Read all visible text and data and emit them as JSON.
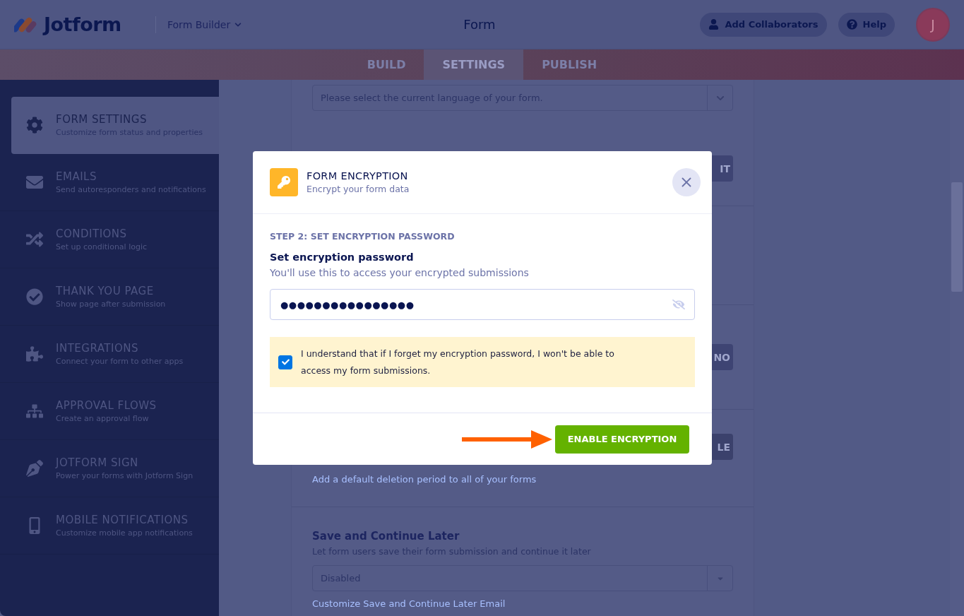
{
  "header": {
    "logo": "Jotform",
    "builder_menu": "Form Builder",
    "title": "Form",
    "buttons": [
      {
        "kind": "collaborators",
        "label": "Add Collaborators"
      },
      {
        "kind": "help",
        "label": "Help"
      }
    ],
    "avatar": "J"
  },
  "tabs": [
    {
      "label": "BUILD",
      "selected": false
    },
    {
      "label": "SETTINGS",
      "selected": true
    },
    {
      "label": "PUBLISH",
      "selected": false
    }
  ],
  "sidebar": {
    "items": [
      {
        "kind": "gear",
        "title": "FORM SETTINGS",
        "subtitle": "Customize form status and properties",
        "selected": true
      },
      {
        "kind": "mail",
        "title": "EMAILS",
        "subtitle": "Send autoresponders and notifications",
        "selected": false
      },
      {
        "kind": "shuffle",
        "title": "CONDITIONS",
        "subtitle": "Set up conditional logic",
        "selected": false
      },
      {
        "kind": "check",
        "title": "THANK YOU PAGE",
        "subtitle": "Show page after submission",
        "selected": false
      },
      {
        "kind": "puzzle",
        "title": "INTEGRATIONS",
        "subtitle": "Connect your form to other apps",
        "selected": false
      },
      {
        "kind": "flow",
        "title": "APPROVAL FLOWS",
        "subtitle": "Create an approval flow",
        "selected": false
      },
      {
        "kind": "pen",
        "title": "JOTFORM SIGN",
        "subtitle": "Power your forms with Jotform Sign",
        "selected": false
      },
      {
        "kind": "mobile",
        "title": "MOBILE NOTIFICATIONS",
        "subtitle": "Customize mobile app notifications",
        "selected": false
      }
    ]
  },
  "settings": {
    "language_select": {
      "placeholder": "Please select the current language of your form."
    },
    "partial_buttons": [
      "IT",
      "NO",
      "LE"
    ],
    "deletion_link": "Add a default deletion period to all of your forms",
    "save_continue": {
      "title": "Save and Continue Later",
      "description": "Let form users save their form submission and continue it later",
      "value": "Disabled",
      "link": "Customize Save and Continue Later Email"
    }
  },
  "modal": {
    "title": "FORM ENCRYPTION",
    "subtitle": "Encrypt your form data",
    "step": "STEP 2: SET ENCRYPTION PASSWORD",
    "label": "Set encryption password",
    "hint": "You'll use this to access your encrypted submissions",
    "password": "●●●●●●●●●●●●●●●●",
    "agreement": {
      "text": "I understand that if I forget my encryption password, I won't be able to access my form submissions.",
      "checked": true
    },
    "button": "ENABLE ENCRYPTION"
  }
}
